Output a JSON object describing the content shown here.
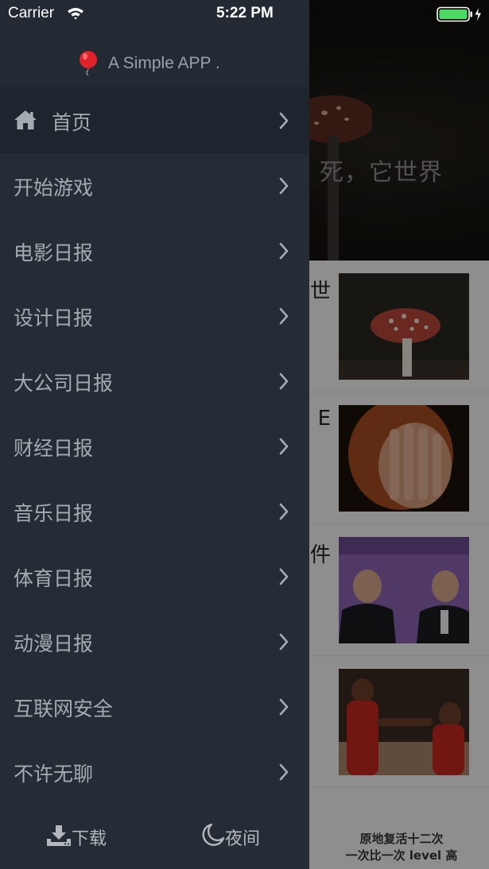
{
  "status_bar": {
    "carrier": "Carrier",
    "time": "5:22 PM",
    "wifi_icon": "wifi-icon",
    "battery_icon": "battery-icon",
    "battery_color": "#4cd964"
  },
  "drawer": {
    "app_title": "A Simple APP .",
    "header_icon": "balloon-icon",
    "menu": [
      {
        "label": "首页",
        "icon": "home-icon",
        "active": true
      },
      {
        "label": "开始游戏"
      },
      {
        "label": "电影日报"
      },
      {
        "label": "设计日报"
      },
      {
        "label": "大公司日报"
      },
      {
        "label": "财经日报"
      },
      {
        "label": "音乐日报"
      },
      {
        "label": "体育日报"
      },
      {
        "label": "动漫日报"
      },
      {
        "label": "互联网安全"
      },
      {
        "label": "不许无聊"
      }
    ],
    "footer": {
      "download_label": "下载",
      "download_icon": "download-icon",
      "night_label": "夜间",
      "night_icon": "moon-icon"
    },
    "colors": {
      "background": "#252c36",
      "active_row": "#1f252e",
      "text": "#a6abb2"
    }
  },
  "background": {
    "hero_title": "死，它世界",
    "news": [
      {
        "title": "世"
      },
      {
        "title": "E"
      },
      {
        "title": "件"
      },
      {
        "title": ""
      }
    ],
    "bottom_caption_line1": "原地复活十二次",
    "bottom_caption_line2": "一次比一次 level 高"
  }
}
